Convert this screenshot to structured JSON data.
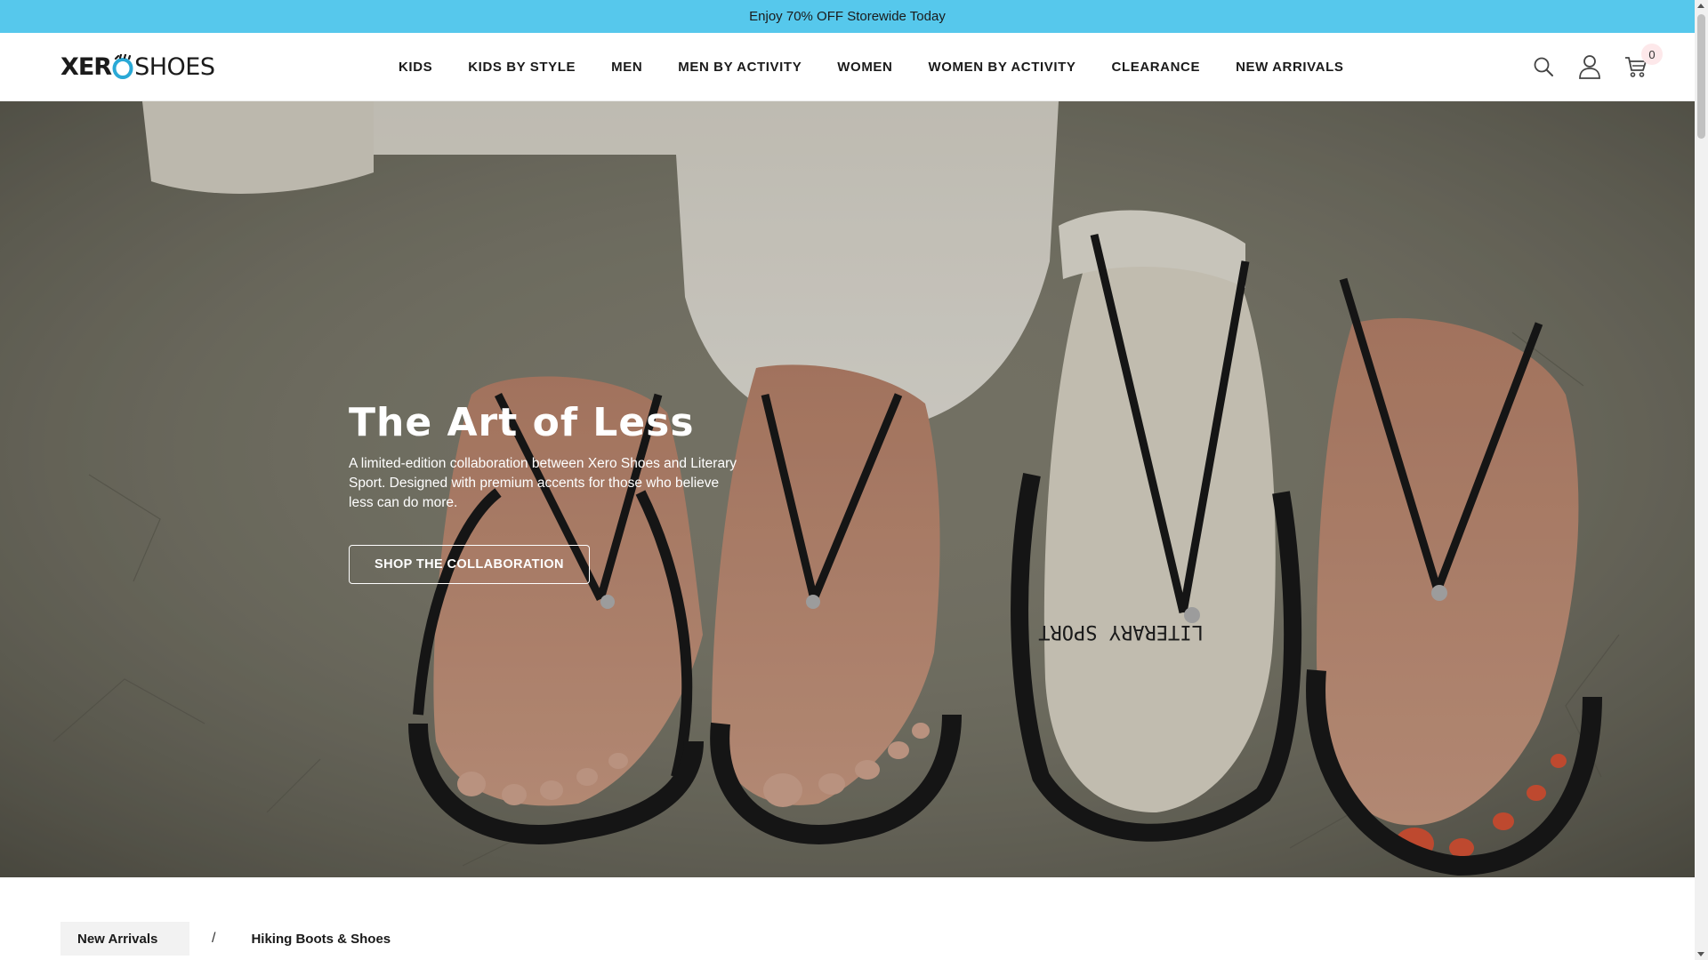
{
  "announcement": {
    "text": "Enjoy 70% OFF Storewide Today"
  },
  "logo": {
    "left_text": "XER",
    "right_text": "SHOES",
    "icon": "xero-o-logo-icon"
  },
  "nav": {
    "items": [
      {
        "label": "KIDS"
      },
      {
        "label": "KIDS BY STYLE"
      },
      {
        "label": "MEN"
      },
      {
        "label": "MEN BY ACTIVITY"
      },
      {
        "label": "WOMEN"
      },
      {
        "label": "WOMEN BY ACTIVITY"
      },
      {
        "label": "CLEARANCE"
      },
      {
        "label": "NEW ARRIVALS"
      }
    ]
  },
  "header_icons": {
    "search": "search-icon",
    "account": "user-icon",
    "cart": "cart-icon",
    "cart_count": "0"
  },
  "hero": {
    "title": "The Art of Less",
    "description": "A limited-edition collaboration between Xero Shoes and Literary Sport. Designed with premium accents for those who believe less can do more.",
    "button_label": "SHOP THE COLLABORATION",
    "sock_text": "LITERARY SPORT"
  },
  "breadcrumb": {
    "items": [
      {
        "label": "New Arrivals"
      },
      {
        "label": "Hiking Boots & Shoes"
      }
    ],
    "separator": "/"
  },
  "colors": {
    "announcement_bg": "#56c8ec",
    "logo_accent": "#2aa9d6",
    "cart_badge_bg": "#fde8ea"
  }
}
